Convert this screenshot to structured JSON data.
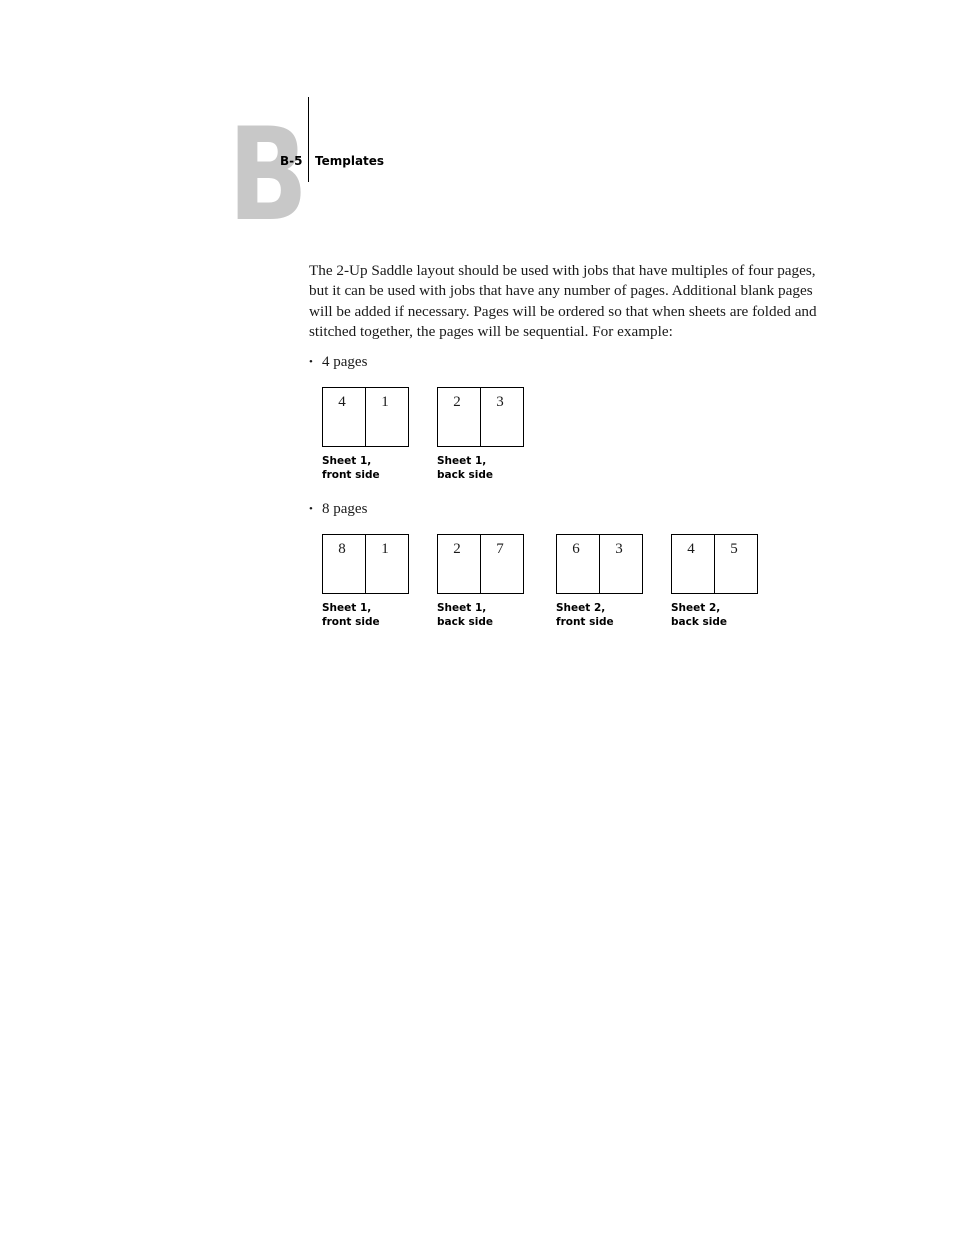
{
  "header": {
    "chapter_letter": "B",
    "page_number": "B-5",
    "section_title": "Templates"
  },
  "body": {
    "paragraph": "The 2-Up Saddle layout should be used with jobs that have multiples of four pages, but it can be used with jobs that have any number of pages. Additional blank pages will be added if necessary. Pages will be ordered so that when sheets are folded and stitched together, the pages will be sequential. For example:"
  },
  "examples": [
    {
      "bullet": "4 pages",
      "sheets": [
        {
          "left": "4",
          "right": "1",
          "caption_line1": "Sheet 1,",
          "caption_line2": "front side"
        },
        {
          "left": "2",
          "right": "3",
          "caption_line1": "Sheet 1,",
          "caption_line2": "back side"
        }
      ]
    },
    {
      "bullet": "8 pages",
      "sheets": [
        {
          "left": "8",
          "right": "1",
          "caption_line1": "Sheet 1,",
          "caption_line2": "front side"
        },
        {
          "left": "2",
          "right": "7",
          "caption_line1": "Sheet 1,",
          "caption_line2": "back side"
        },
        {
          "left": "6",
          "right": "3",
          "caption_line1": "Sheet 2,",
          "caption_line2": "front side"
        },
        {
          "left": "4",
          "right": "5",
          "caption_line1": "Sheet 2,",
          "caption_line2": "back side"
        }
      ]
    }
  ]
}
